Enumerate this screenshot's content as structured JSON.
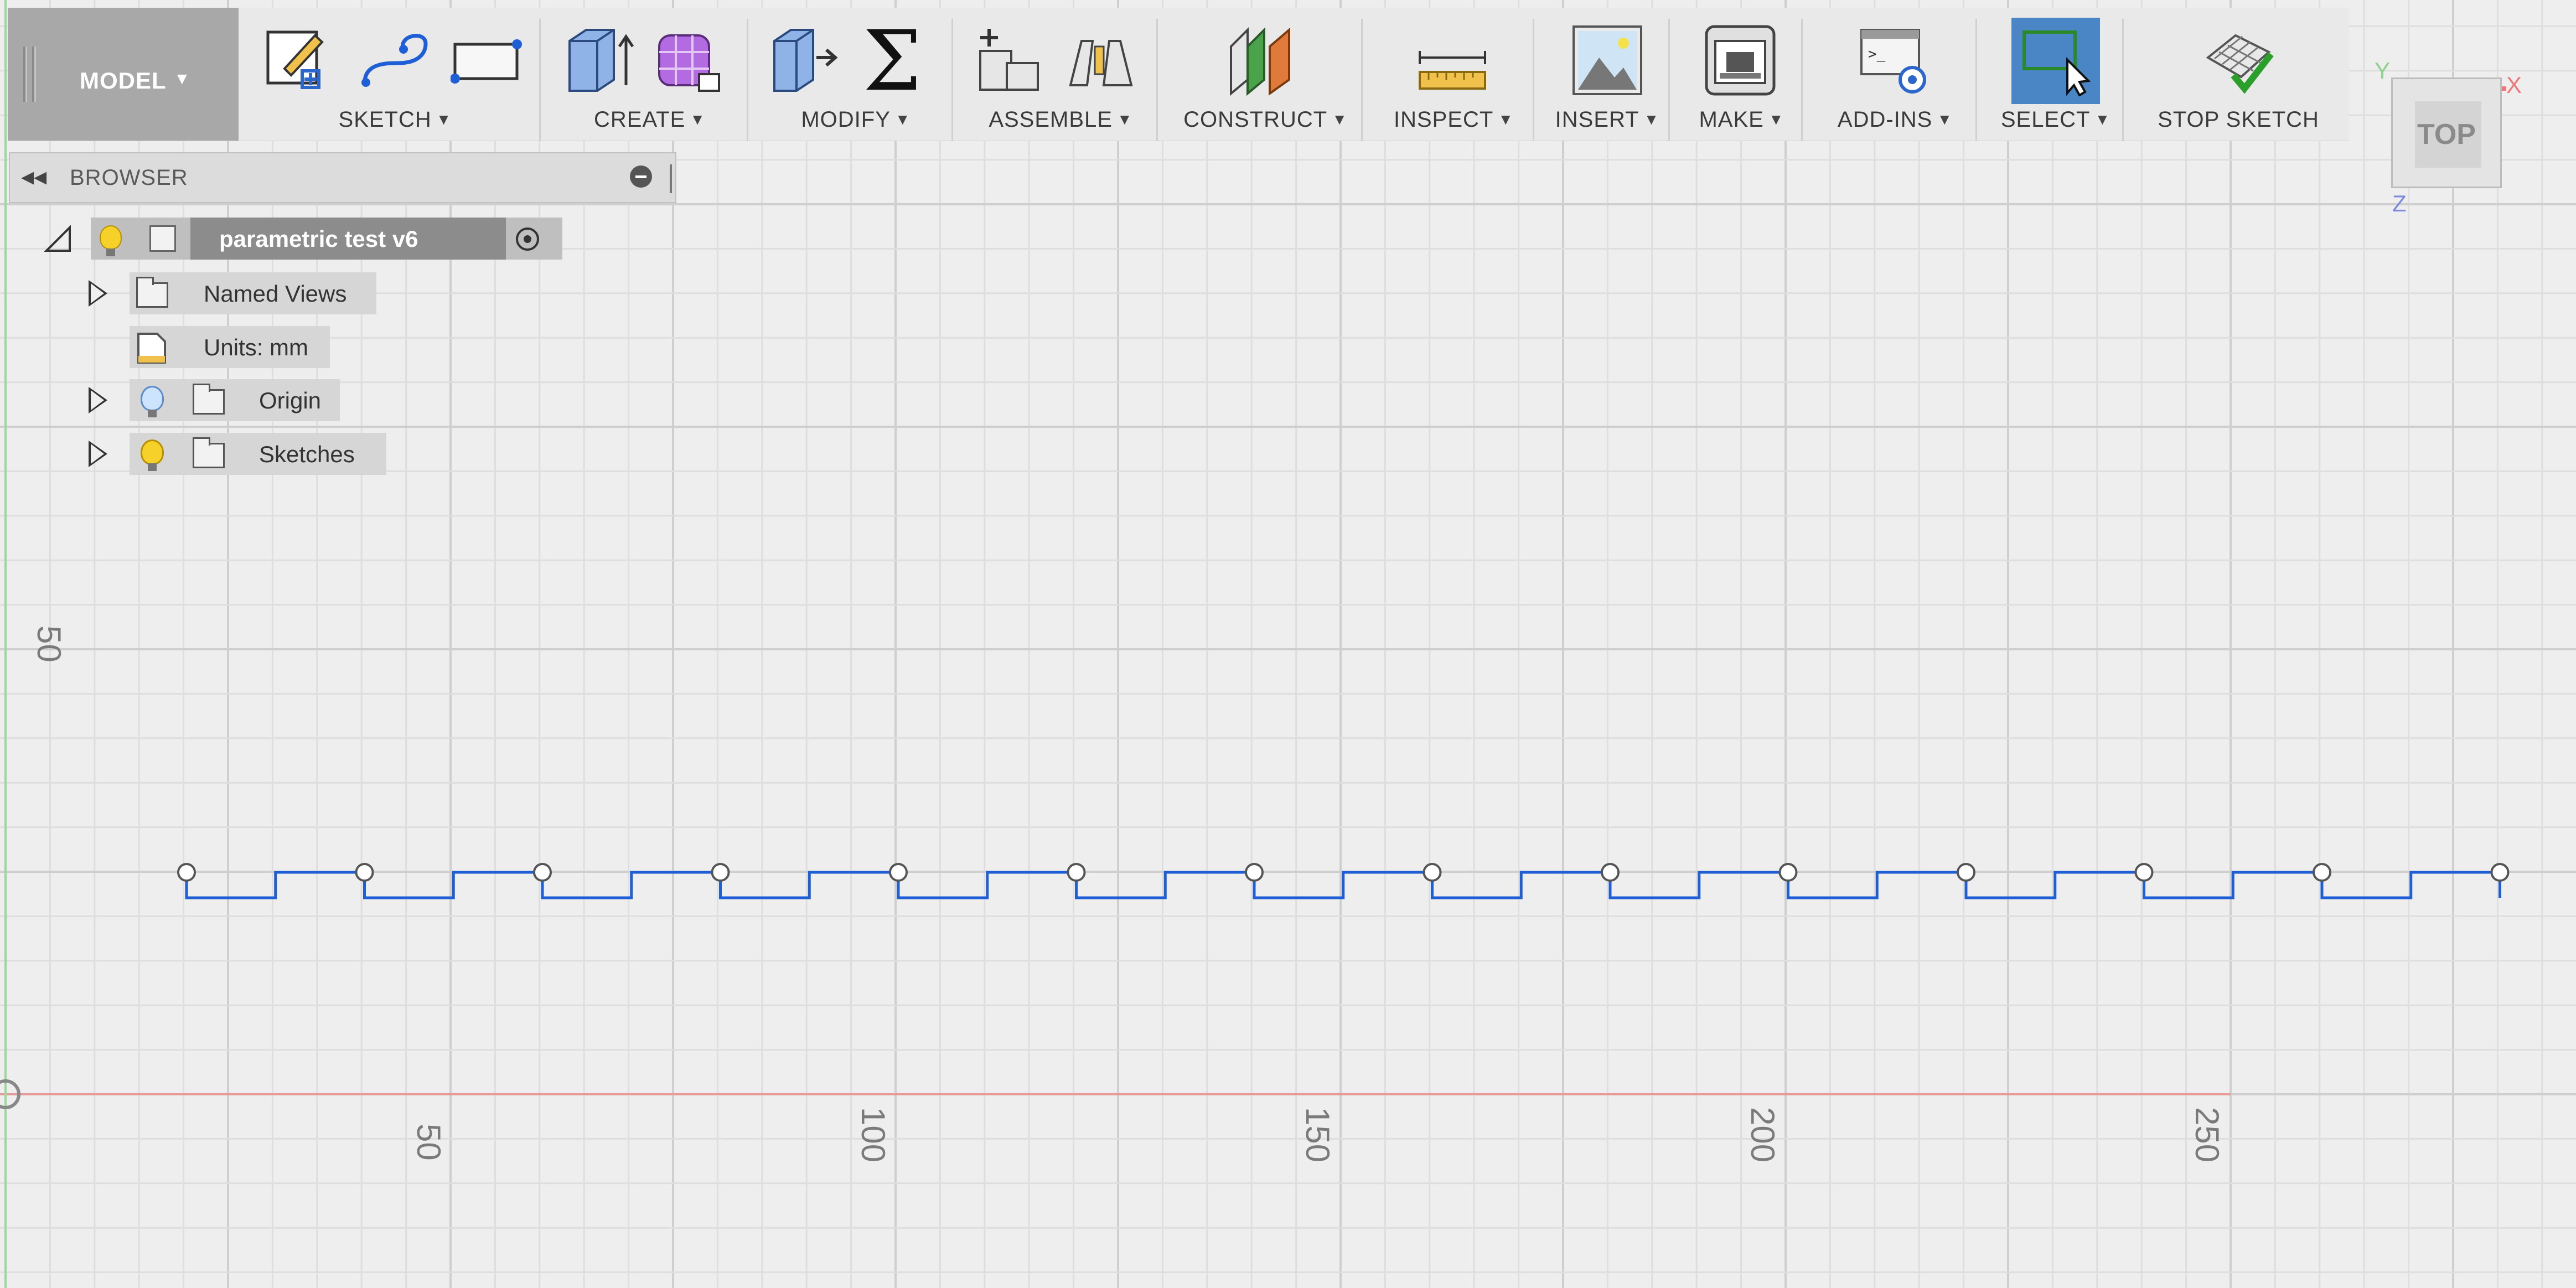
{
  "toolbar": {
    "model_label": "MODEL",
    "groups": [
      {
        "label": "SKETCH",
        "caret": "▼"
      },
      {
        "label": "CREATE",
        "caret": "▼"
      },
      {
        "label": "MODIFY",
        "caret": "▼"
      },
      {
        "label": "ASSEMBLE",
        "caret": "▼"
      },
      {
        "label": "CONSTRUCT",
        "caret": "▼"
      },
      {
        "label": "INSPECT",
        "caret": "▼"
      },
      {
        "label": "INSERT",
        "caret": "▼"
      },
      {
        "label": "MAKE",
        "caret": "▼"
      },
      {
        "label": "ADD-INS",
        "caret": "▼"
      },
      {
        "label": "SELECT",
        "caret": "▼"
      },
      {
        "label": "STOP SKETCH",
        "caret": ""
      }
    ],
    "icons": [
      "create-sketch-icon",
      "arc-icon",
      "rectangle-icon",
      "extrude-icon",
      "form-icon",
      "press-pull-icon",
      "sigma-parameters-icon",
      "new-component-icon",
      "joint-icon",
      "offset-plane-icon",
      "measure-ruler-icon",
      "insert-image-icon",
      "3d-print-icon",
      "scripts-addins-icon",
      "select-cursor-icon",
      "stop-sketch-check-icon"
    ],
    "accent_select": "#4a86c5"
  },
  "browser": {
    "title": "BROWSER",
    "root": "parametric test v6",
    "items": [
      {
        "label": "Named Views"
      },
      {
        "label": "Units: mm"
      },
      {
        "label": "Origin"
      },
      {
        "label": "Sketches"
      }
    ]
  },
  "viewcube": {
    "face_label": "TOP",
    "axis_x": "X",
    "axis_y": "Y",
    "axis_z": "Z"
  },
  "ruler": {
    "y_label": "50",
    "x_labels": [
      "50",
      "100",
      "150",
      "200",
      "250"
    ]
  },
  "colors": {
    "sketch_line": "#1f5fd6",
    "x_axis": "#e79a9a",
    "y_axis": "#9bd89b",
    "grid_minor": "#dedede",
    "grid_major": "#cfcfcf"
  }
}
